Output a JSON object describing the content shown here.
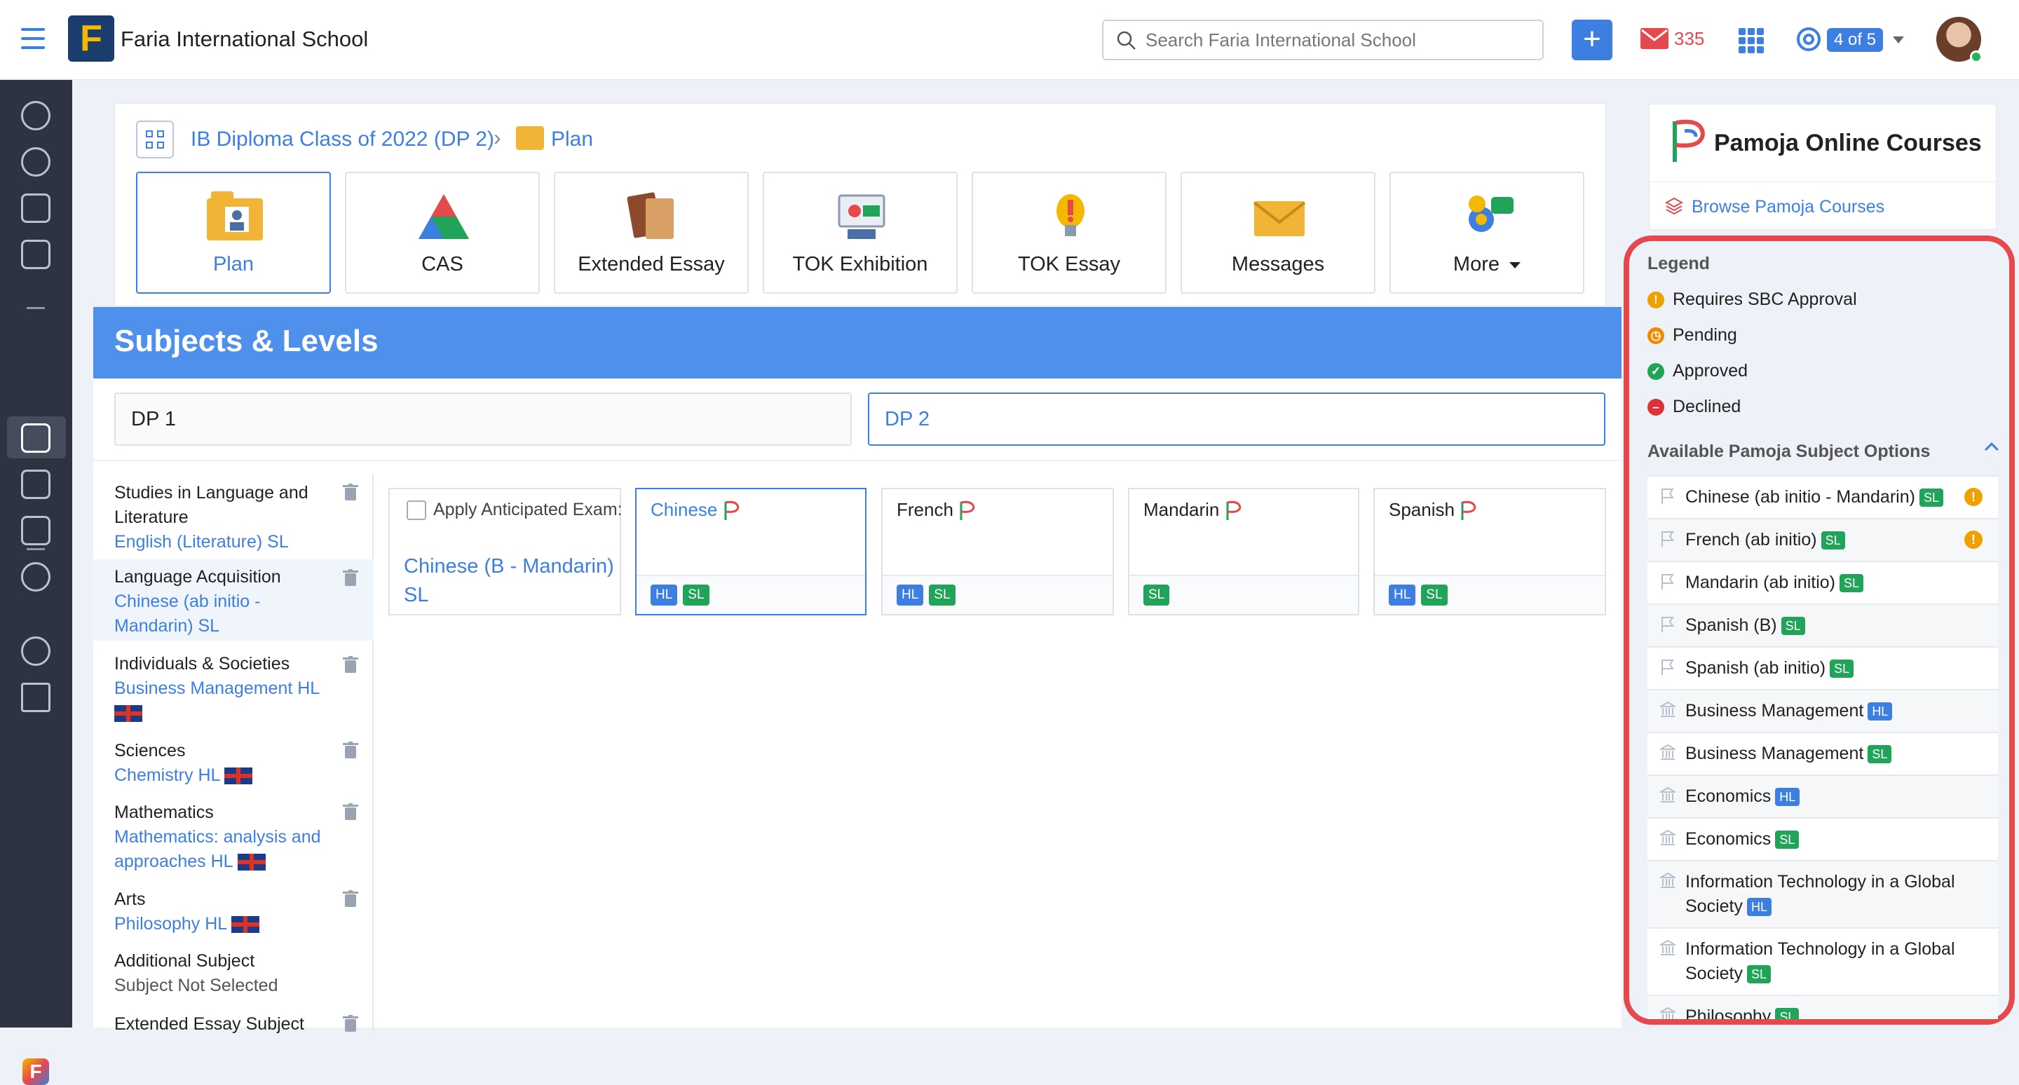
{
  "header": {
    "school_name": "Faria International School",
    "logo_letter": "F",
    "search_placeholder": "Search Faria International School",
    "add_label": "+",
    "mail_count": "335",
    "help_counter": "4 of 5"
  },
  "breadcrumb": {
    "class": "IB Diploma Class of 2022 (DP 2)",
    "separator": "›",
    "page": "Plan"
  },
  "tiles": [
    {
      "label": "Plan",
      "icon": "plan-folder-icon"
    },
    {
      "label": "CAS",
      "icon": "cas-triangle-icon"
    },
    {
      "label": "Extended Essay",
      "icon": "books-icon"
    },
    {
      "label": "TOK Exhibition",
      "icon": "exhibition-icon"
    },
    {
      "label": "TOK Essay",
      "icon": "lightbulb-icon"
    },
    {
      "label": "Messages",
      "icon": "envelope-icon"
    },
    {
      "label": "More",
      "icon": "more-icon"
    }
  ],
  "subjects": {
    "title": "Subjects & Levels",
    "tabs": [
      "DP 1",
      "DP 2"
    ],
    "groups": [
      {
        "category": "Studies in Language and Literature",
        "value": "English (Literature) SL"
      },
      {
        "category": "Language Acquisition",
        "value": "Chinese (ab initio - Mandarin) SL"
      },
      {
        "category": "Individuals & Societies",
        "value": "Business Management HL"
      },
      {
        "category": "Sciences",
        "value": "Chemistry HL"
      },
      {
        "category": "Mathematics",
        "value": "Mathematics: analysis and approaches HL"
      },
      {
        "category": "Arts",
        "value": "Philosophy HL"
      },
      {
        "category": "Additional Subject",
        "value": "Subject Not Selected"
      },
      {
        "category": "Extended Essay Subject",
        "value": ""
      }
    ],
    "anticipated": {
      "label": "Apply Anticipated Exam:",
      "value": "Chinese (B - Mandarin) SL"
    },
    "options": [
      {
        "name": "Chinese",
        "badges": [
          "HL",
          "SL"
        ]
      },
      {
        "name": "French",
        "badges": [
          "HL",
          "SL"
        ]
      },
      {
        "name": "Mandarin",
        "badges": [
          "SL"
        ]
      },
      {
        "name": "Spanish",
        "badges": [
          "HL",
          "SL"
        ]
      }
    ]
  },
  "pamoja": {
    "title": "Pamoja Online Courses",
    "browse": "Browse Pamoja Courses",
    "legend_title": "Legend",
    "legend": [
      {
        "label": "Requires SBC Approval",
        "color": "#f0a000",
        "glyph": "!"
      },
      {
        "label": "Pending",
        "color": "#f08a00",
        "glyph": "◷"
      },
      {
        "label": "Approved",
        "color": "#22a35a",
        "glyph": "✓"
      },
      {
        "label": "Declined",
        "color": "#d9343a",
        "glyph": "–"
      }
    ],
    "available_title": "Available Pamoja Subject Options",
    "courses": [
      {
        "name": "Chinese (ab initio - Mandarin)",
        "level": "SL",
        "icon": "flag-icon",
        "warn": true
      },
      {
        "name": "French (ab initio)",
        "level": "SL",
        "icon": "flag-icon",
        "warn": true
      },
      {
        "name": "Mandarin (ab initio)",
        "level": "SL",
        "icon": "flag-icon",
        "warn": false
      },
      {
        "name": "Spanish (B)",
        "level": "SL",
        "icon": "flag-icon",
        "warn": false
      },
      {
        "name": "Spanish (ab initio)",
        "level": "SL",
        "icon": "flag-icon",
        "warn": false
      },
      {
        "name": "Business Management",
        "level": "HL",
        "icon": "institution-icon",
        "warn": false
      },
      {
        "name": "Business Management",
        "level": "SL",
        "icon": "institution-icon",
        "warn": false
      },
      {
        "name": "Economics",
        "level": "HL",
        "icon": "institution-icon",
        "warn": false
      },
      {
        "name": "Economics",
        "level": "SL",
        "icon": "institution-icon",
        "warn": false
      },
      {
        "name": "Information Technology in a Global Society",
        "level": "HL",
        "icon": "institution-icon",
        "warn": false
      },
      {
        "name": "Information Technology in a Global Society",
        "level": "SL",
        "icon": "institution-icon",
        "warn": false
      },
      {
        "name": "Philosophy",
        "level": "SL",
        "icon": "institution-icon",
        "warn": false
      }
    ]
  },
  "colors": {
    "accent": "#3d7fe0",
    "hl_badge": "#3d7fe0",
    "sl_badge": "#22a35a",
    "highlight": "#e5484d",
    "sidebar": "#2d3340"
  }
}
